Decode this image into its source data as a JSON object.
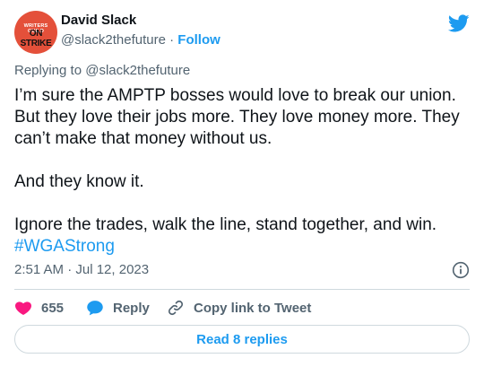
{
  "author": {
    "name": "David Slack",
    "handle": "@slack2thefuture",
    "separator": "·",
    "follow_label": "Follow",
    "avatar_top_text": "WRITERS GUILD",
    "avatar_main_text": "ON STRIKE"
  },
  "replying_to": "Replying to @slack2thefuture",
  "tweet": {
    "paragraph_1": "I’m sure the AMPTP bosses would love to break our union. But they love their jobs more. They love money more. They can’t make that money without us.",
    "paragraph_2": "And they know it.",
    "paragraph_3": "Ignore the trades, walk the line, stand together, and win.",
    "hashtag": "#WGAStrong"
  },
  "timestamp": "2:51 AM · Jul 12, 2023",
  "actions": {
    "like_count": "655",
    "reply_label": "Reply",
    "copy_label": "Copy link to Tweet"
  },
  "read_replies_label": "Read 8 replies",
  "colors": {
    "accent": "#1d9bf0",
    "like": "#f91880",
    "avatar_bg": "#e4503a"
  },
  "icons": [
    "twitter-bird-icon",
    "info-icon",
    "heart-icon",
    "reply-bubble-icon",
    "link-icon"
  ]
}
